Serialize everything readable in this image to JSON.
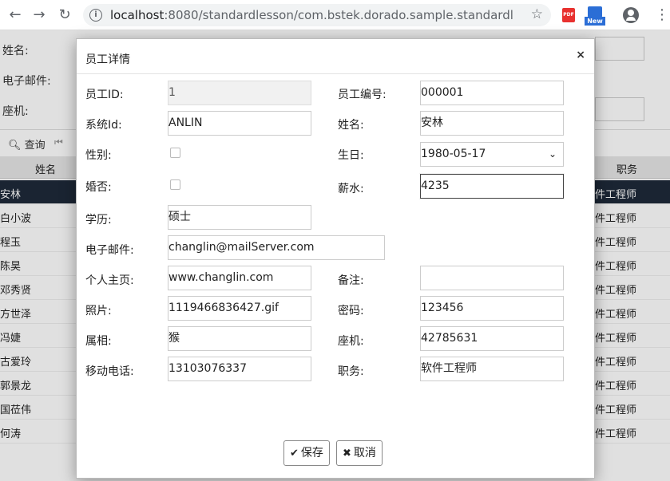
{
  "browser": {
    "url_host": "localhost",
    "url_rest": ":8080/standardlesson/com.bstek.dorado.sample.standardlesson....",
    "ext_pdf": "PDF",
    "ext_new": "New"
  },
  "background": {
    "fields": [
      "姓名:",
      "电子邮件:",
      "座机:"
    ],
    "toolbar_query": "查询",
    "columns": [
      "姓名",
      "职务"
    ],
    "rows": [
      {
        "name": "安林",
        "job": "件工程师"
      },
      {
        "name": "白小波",
        "job": "件工程师"
      },
      {
        "name": "程玉",
        "job": "件工程师"
      },
      {
        "name": "陈昊",
        "job": "件工程师"
      },
      {
        "name": "邓秀贤",
        "job": "件工程师"
      },
      {
        "name": "方世泽",
        "job": "件工程师"
      },
      {
        "name": "冯婕",
        "job": "件工程师"
      },
      {
        "name": "古爱玲",
        "job": "件工程师"
      },
      {
        "name": "郭景龙",
        "job": "件工程师"
      },
      {
        "name": "国莅伟",
        "job": "件工程师"
      },
      {
        "name": "何涛",
        "job": "件工程师"
      }
    ]
  },
  "dialog": {
    "title": "员工详情",
    "close": "×",
    "labels": {
      "id": "员工ID:",
      "code": "员工编号:",
      "sysid": "系统Id:",
      "name": "姓名:",
      "sex": "性别:",
      "birthday": "生日:",
      "married": "婚否:",
      "salary": "薪水:",
      "degree": "学历:",
      "email": "电子邮件:",
      "homepage": "个人主页:",
      "remark": "备注:",
      "photo": "照片:",
      "password": "密码:",
      "zodiac": "属相:",
      "phone": "座机:",
      "mobile": "移动电话:",
      "position": "职务:"
    },
    "values": {
      "id": "1",
      "code": "000001",
      "sysid": "ANLIN",
      "name": "安林",
      "birthday": "1980-05-17",
      "salary": "4235",
      "degree": "硕士",
      "email": "changlin@mailServer.com",
      "homepage": "www.changlin.com",
      "remark": "",
      "photo": "1119466836427.gif",
      "password": "123456",
      "zodiac": "猴",
      "phone": "42785631",
      "mobile": "13103076337",
      "position": "软件工程师"
    },
    "checkboxes": {
      "sex": false,
      "married": false
    },
    "buttons": {
      "save": "保存",
      "cancel": "取消"
    }
  }
}
